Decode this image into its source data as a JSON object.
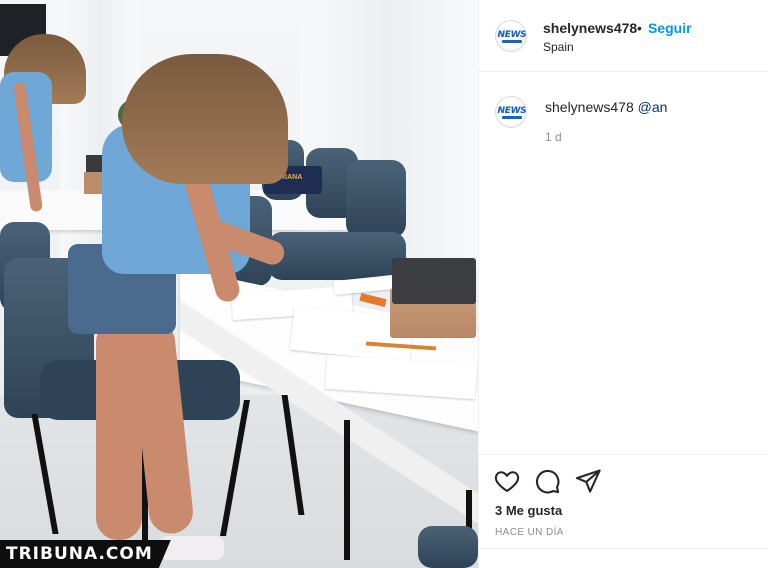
{
  "photo": {
    "watermark": "TRIBUNA.COM",
    "navy_box_text": "ADRIANA"
  },
  "header": {
    "username": "shelynews478",
    "separator": "•",
    "follow_label": "Seguir",
    "location": "Spain",
    "avatar_logo": "NEWS"
  },
  "comment": {
    "username": "shelynews478",
    "mention": "@an",
    "time": "1 d",
    "avatar_logo": "NEWS"
  },
  "actions": {
    "icons": [
      "heart-icon",
      "comment-icon",
      "share-icon"
    ],
    "likes": "3 Me gusta",
    "timestamp": "HACE UN DÍA"
  },
  "colors": {
    "accent": "#0095f6",
    "mention": "#00376b",
    "muted": "#8e8e8e"
  }
}
